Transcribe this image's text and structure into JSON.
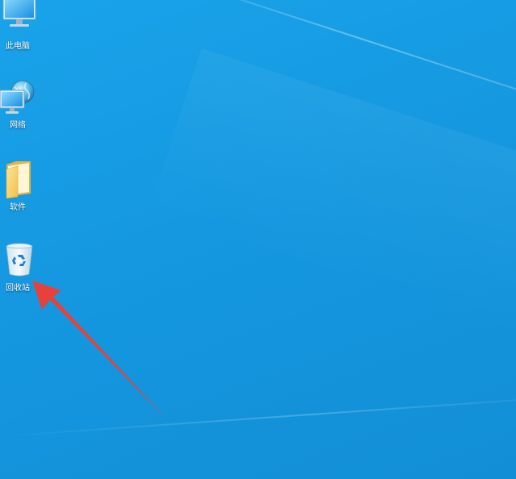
{
  "desktop": {
    "icons": [
      {
        "label": "此电脑",
        "icon": "computer-icon"
      },
      {
        "label": "网络",
        "icon": "network-icon"
      },
      {
        "label": "软件",
        "icon": "folder-icon"
      },
      {
        "label": "回收站",
        "icon": "recycle-bin-icon"
      }
    ]
  },
  "annotation": {
    "arrow_color": "#e8413b"
  },
  "colors": {
    "background": "#1598e0"
  }
}
